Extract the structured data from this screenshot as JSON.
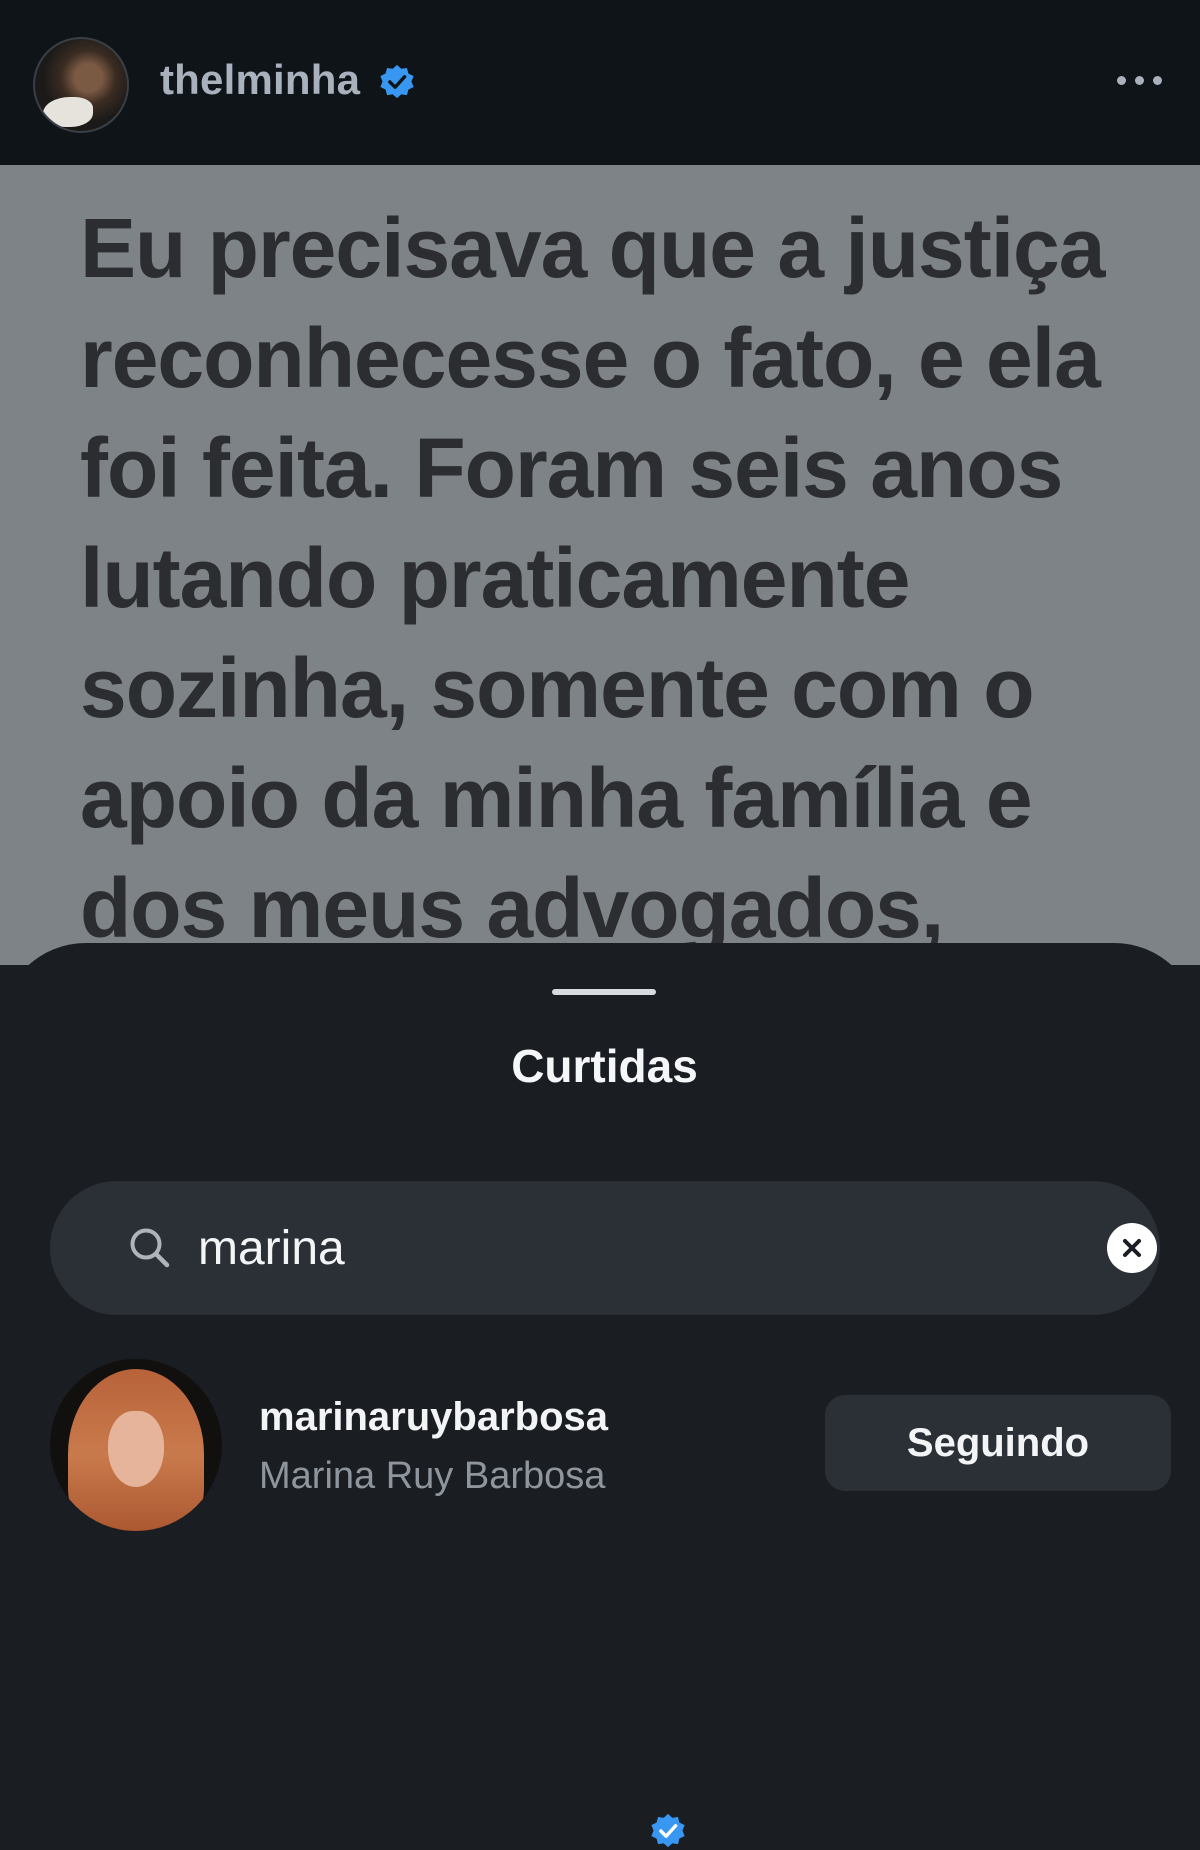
{
  "post": {
    "username": "thelminha",
    "verified": true,
    "more_icon": "ellipsis-horizontal-icon",
    "text": "Eu precisava que a justiça reconhecesse o fato, e ela foi feita. Foram seis anos lutando praticamente sozinha, somente com o apoio da minha família e dos meus advogados,"
  },
  "sheet": {
    "title": "Curtidas",
    "search": {
      "value": "marina",
      "icon": "search-icon",
      "clear_icon": "clear-circle-icon"
    },
    "results": [
      {
        "username": "marinaruybarbosa",
        "verified": true,
        "full_name": "Marina Ruy Barbosa",
        "button_label": "Seguindo"
      }
    ]
  },
  "colors": {
    "verified_blue": "#3897f0",
    "sheet_bg": "#1a1d22",
    "post_bg": "#7d8386"
  }
}
